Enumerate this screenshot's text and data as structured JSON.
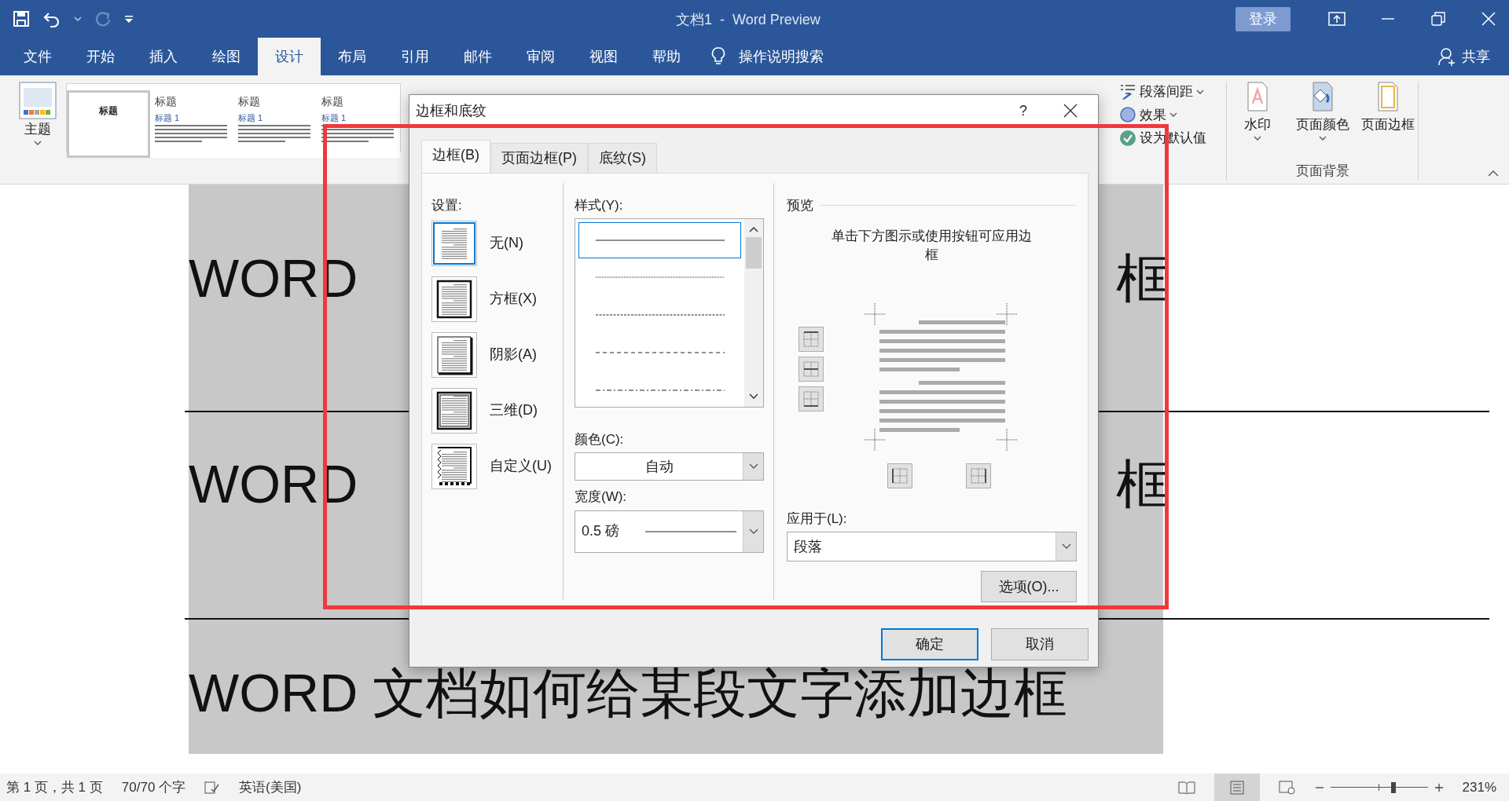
{
  "window": {
    "title": "文档1  -  Word Preview",
    "sign_in": "登录"
  },
  "quick_access": {
    "redo_disabled": true
  },
  "menu_tabs": [
    {
      "label": "文件",
      "selected": false
    },
    {
      "label": "开始",
      "selected": false
    },
    {
      "label": "插入",
      "selected": false
    },
    {
      "label": "绘图",
      "selected": false
    },
    {
      "label": "设计",
      "selected": true
    },
    {
      "label": "布局",
      "selected": false
    },
    {
      "label": "引用",
      "selected": false
    },
    {
      "label": "邮件",
      "selected": false
    },
    {
      "label": "审阅",
      "selected": false
    },
    {
      "label": "视图",
      "selected": false
    },
    {
      "label": "帮助",
      "selected": false
    }
  ],
  "tell_me": "操作说明搜索",
  "share": "共享",
  "ribbon": {
    "theme_label": "主题",
    "gallery": [
      {
        "title": "标题",
        "selected": true
      },
      {
        "title": "标题",
        "heading": "标题 1",
        "selected": false
      },
      {
        "title": "标题",
        "heading": "标题 1",
        "selected": false
      },
      {
        "title": "标题",
        "heading": "标题 1",
        "selected": false
      }
    ],
    "paragraph_spacing": "段落间距",
    "effects": "效果",
    "set_default": "设为默认值",
    "page_background": {
      "items": [
        "水印",
        "页面颜色",
        "页面边框"
      ],
      "group_label": "页面背景"
    }
  },
  "document": {
    "paragraphs": [
      {
        "parts": [
          "WORD",
          "框"
        ]
      },
      {
        "parts": [
          "WORD",
          "框"
        ]
      },
      {
        "parts": [
          "WORD 文档如何给某段文字添加边框"
        ]
      }
    ]
  },
  "dialog": {
    "title": "边框和底纹",
    "help": "?",
    "tabs": [
      {
        "label": "边框(B)",
        "selected": true
      },
      {
        "label": "页面边框(P)",
        "selected": false
      },
      {
        "label": "底纹(S)",
        "selected": false
      }
    ],
    "settings_label": "设置:",
    "settings": [
      {
        "label": "无(N)",
        "kind": "none",
        "selected": true
      },
      {
        "label": "方框(X)",
        "kind": "box",
        "selected": false
      },
      {
        "label": "阴影(A)",
        "kind": "shadow",
        "selected": false
      },
      {
        "label": "三维(D)",
        "kind": "threed",
        "selected": false
      },
      {
        "label": "自定义(U)",
        "kind": "custom",
        "selected": false
      }
    ],
    "style_label": "样式(Y):",
    "styles": [
      {
        "kind": "solid",
        "selected": true
      },
      {
        "kind": "dotted",
        "selected": false
      },
      {
        "kind": "fine-dash",
        "selected": false
      },
      {
        "kind": "dash",
        "selected": false
      },
      {
        "kind": "dash-dot",
        "selected": false
      }
    ],
    "color_label": "颜色(C):",
    "color_value": "自动",
    "width_label": "宽度(W):",
    "width_value": "0.5 磅",
    "preview_label": "预览",
    "preview_hint": "单击下方图示或使用按钮可应用边框",
    "apply_label": "应用于(L):",
    "apply_value": "段落",
    "options_button": "选项(O)...",
    "ok": "确定",
    "cancel": "取消"
  },
  "annotation": {
    "kind": "red-frame"
  },
  "status_bar": {
    "page": "第 1 页，共 1 页",
    "words": "70/70 个字",
    "language": "英语(美国)",
    "zoom": "231%",
    "zoom_slider": {
      "level": 0.65
    }
  }
}
